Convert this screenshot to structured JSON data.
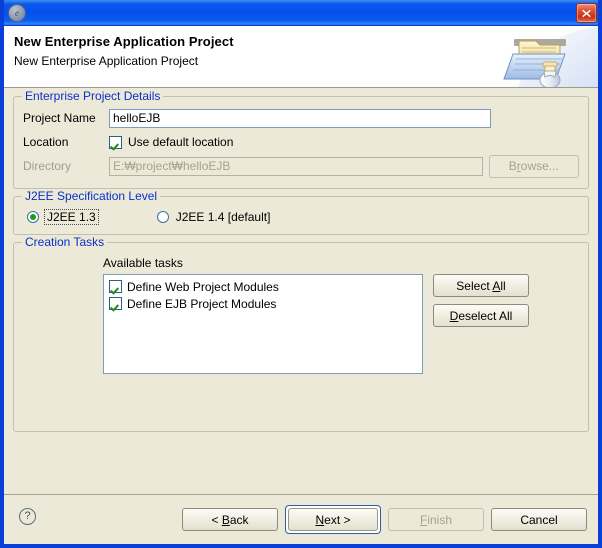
{
  "window": {
    "title": "",
    "icon": "app-icon",
    "close_label": "×"
  },
  "banner": {
    "title": "New Enterprise Application Project",
    "subtitle": "New Enterprise Application Project",
    "art": "folder-with-bean-icon"
  },
  "details": {
    "legend": "Enterprise Project Details",
    "project_name_label": "Project Name",
    "project_name_value": "helloEJB",
    "project_name_placeholder": "",
    "location_label": "Location",
    "use_default_location_label": "Use default location",
    "use_default_location_checked": true,
    "directory_label": "Directory",
    "directory_value": "E:₩project₩helloEJB",
    "directory_placeholder": "",
    "browse_label": "Browse...",
    "browse_mnemonic": "r",
    "browse_enabled": false
  },
  "spec": {
    "legend": "J2EE Specification Level",
    "options": [
      {
        "label": "J2EE 1.3",
        "selected": true,
        "focused": true
      },
      {
        "label": "J2EE 1.4 [default]",
        "selected": false,
        "focused": false
      }
    ]
  },
  "tasks": {
    "legend": "Creation Tasks",
    "available_label": "Available tasks",
    "items": [
      {
        "label": "Define Web Project Modules",
        "checked": true
      },
      {
        "label": "Define EJB Project Modules",
        "checked": true
      }
    ],
    "select_all_label": "Select All",
    "select_all_mnemonic": "A",
    "deselect_all_label": "Deselect All",
    "deselect_all_mnemonic": "D"
  },
  "footer": {
    "help_label": "?",
    "back_label": "< Back",
    "back_mnemonic": "B",
    "next_label": "Next >",
    "next_mnemonic": "N",
    "next_is_default": true,
    "finish_label": "Finish",
    "finish_mnemonic": "F",
    "finish_enabled": false,
    "cancel_label": "Cancel"
  },
  "colors": {
    "dialog_background": "#ECE9D8",
    "title_bar_blue": "#0650EC",
    "group_legend_blue": "#0A30C8",
    "close_button_red": "#C53118",
    "check_green": "#1C8A1C",
    "field_border": "#7F9DB9"
  }
}
